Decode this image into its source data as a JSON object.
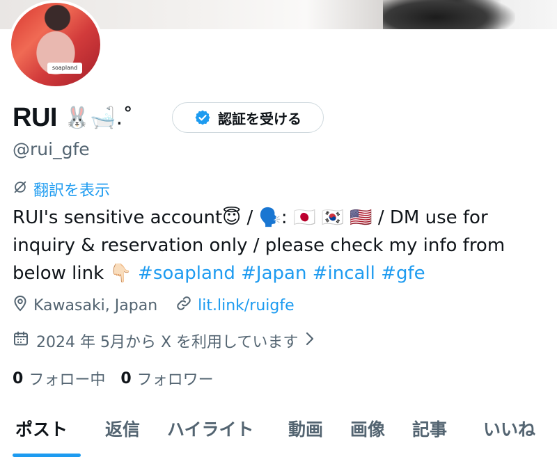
{
  "profile": {
    "display_name": "RUI",
    "name_emoji": "🐰🛁.˚",
    "handle": "@rui_gfe",
    "avatar_sticker": "soapland",
    "verify_button_label": "認証を受ける",
    "translate_label": "翻訳を表示",
    "bio_text": "RUI's sensitive account😇 / 🗣️: 🇯🇵 🇰🇷 🇺🇸 / DM use for inquiry & reservation only / please check my info from below link 👇🏻 ",
    "bio_hashtags": [
      "#soapland",
      "#Japan",
      "#incall",
      "#gfe"
    ],
    "location": "Kawasaki, Japan",
    "website": "lit.link/ruigfe",
    "joined": "2024 年 5月から X を利用しています",
    "following_count": "0",
    "following_label": "フォロー中",
    "followers_count": "0",
    "followers_label": "フォロワー"
  },
  "tabs": [
    {
      "label": "ポスト",
      "active": true
    },
    {
      "label": "返信",
      "active": false
    },
    {
      "label": "ハイライト",
      "active": false
    },
    {
      "label": "動画",
      "active": false
    },
    {
      "label": "画像",
      "active": false
    },
    {
      "label": "記事",
      "active": false
    },
    {
      "label": "いいね",
      "active": false
    }
  ],
  "colors": {
    "accent": "#1d9bf0",
    "text_primary": "#0f1419",
    "text_secondary": "#536471",
    "border": "#cfd9de"
  },
  "icons": {
    "verify": "verified-badge-icon",
    "translate": "translate-icon",
    "location": "location-pin-icon",
    "link": "link-icon",
    "calendar": "calendar-icon",
    "chevron": "chevron-right-icon"
  }
}
